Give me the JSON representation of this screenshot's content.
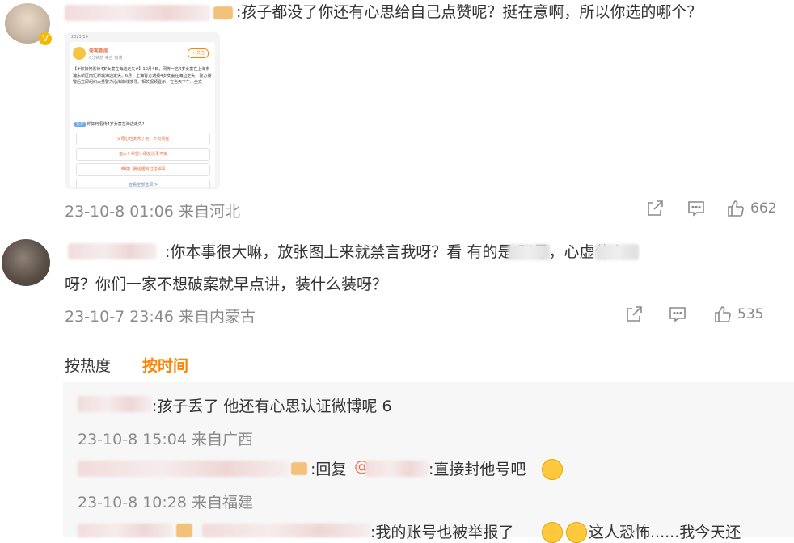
{
  "comments": [
    {
      "text": ":孩子都没了你还有心思给自己点赞呢？挺在意啊，所以你选的哪个？",
      "meta": "23-10-8 01:06 来自河北",
      "likes": "662",
      "card": {
        "date": "2023/10",
        "name": "侠客新闻",
        "time": "6分钟前 来自 微博",
        "follow": "+ 关注",
        "body": "【#你如何看待4岁女童在海边走失#】10月4日，网传一名4岁女童在上海市浦东新区南汇新城海边走失。6月，上海警方通报4岁女童在海边走失，警方接警后立即组织大量警力沿海岸线搜寻。相关视频显示，在当天下午…全文",
        "vote_tag": "投票",
        "vote_title": "你如何看待4岁女童在海边走失?",
        "options": [
          "父母心也太大了吧！不负责任",
          "担心！希望小朋友没事平安",
          "难说！我也遇到过这种事"
        ],
        "more": "查看全部选项 >"
      }
    },
    {
      "text_line1": ":你本事很大嘛，放张图上来就禁言我呀？看      有的是         账号，心虚什么",
      "text_line2": "呀？你们一家不想破案就早点讲，装什么装呀？",
      "meta": "23-10-7 23:46 来自内蒙古",
      "likes": "535"
    }
  ],
  "sort_tabs": {
    "hot": "按热度",
    "time": "按时间"
  },
  "replies": [
    {
      "text": ":孩子丢了 他还有心思认证微博呢 6",
      "meta": "23-10-8 15:04 来自广西"
    },
    {
      "reply_label": ":回复",
      "at": "@",
      "text": ":直接封他号吧",
      "meta": "23-10-8 10:28 来自福建"
    },
    {
      "text": ":我的账号也被举报了",
      "text2": "这人恐怖......我今天还"
    }
  ],
  "colors": {
    "accent": "#ff8200",
    "link": "#eb7350",
    "meta": "#8a8a8a"
  }
}
